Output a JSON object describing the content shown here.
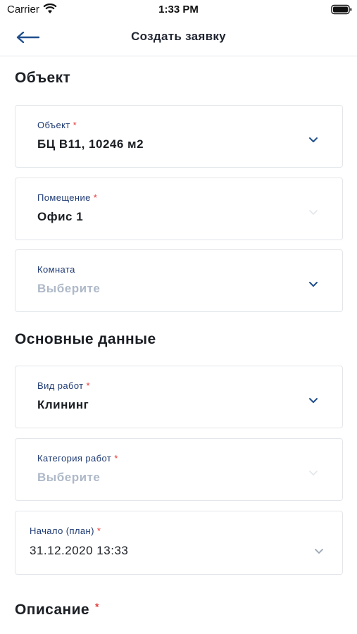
{
  "status_bar": {
    "carrier": "Carrier",
    "time": "1:33 PM",
    "icons": [
      "wifi-icon",
      "battery-icon"
    ]
  },
  "nav": {
    "title": "Создать заявку",
    "back_icon": "arrow-left-icon"
  },
  "sections": {
    "object": "Объект",
    "main_data": "Основные данные",
    "description": "Описание"
  },
  "fields": {
    "object": {
      "label": "Объект",
      "required": "*",
      "value": "БЦ В11, 10246 м2",
      "state": "enabled"
    },
    "premises": {
      "label": "Помещение",
      "required": "*",
      "value": "Офис 1",
      "state": "disabled"
    },
    "room": {
      "label": "Комната",
      "value": "Выберите",
      "placeholder": true,
      "state": "enabled"
    },
    "work_type": {
      "label": "Вид работ",
      "required": "*",
      "value": "Клининг",
      "state": "enabled"
    },
    "work_category": {
      "label": "Категория работ",
      "required": "*",
      "value": "Выберите",
      "placeholder": true,
      "state": "disabled"
    },
    "start_plan": {
      "label": "Начало (план)",
      "required": "*",
      "value": "31.12.2020 13:33",
      "state": "enabled"
    }
  },
  "description_required": "*",
  "colors": {
    "accent": "#1f4e8c",
    "label": "#1f3b73",
    "required": "#e53935",
    "placeholder": "#aeb9c8",
    "border": "#e3e6ea"
  }
}
